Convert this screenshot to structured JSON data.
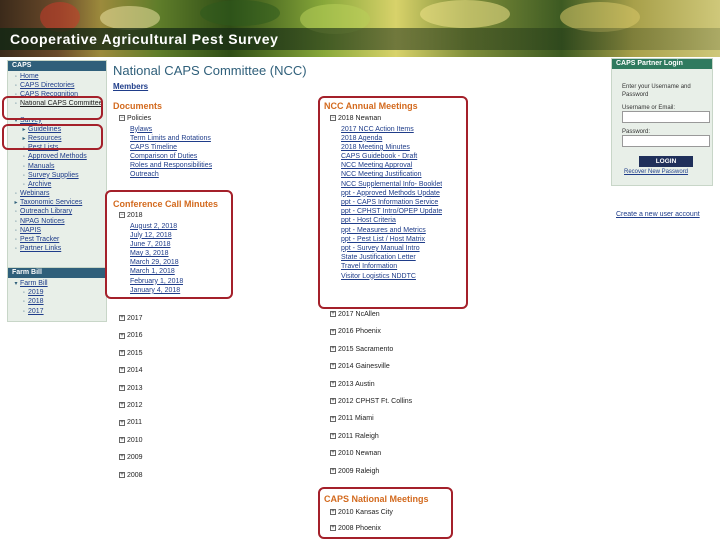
{
  "banner": {
    "title": "Cooperative Agricultural Pest Survey"
  },
  "sidebar": {
    "heading": "CAPS",
    "items": [
      {
        "label": "Home",
        "level": 0
      },
      {
        "label": "CAPS Directories",
        "level": 0
      },
      {
        "label": "CAPS Recognition",
        "level": 0
      },
      {
        "label": "National CAPS Committee",
        "level": 0
      },
      {
        "label": "Survey",
        "level": 0,
        "expanded": true
      },
      {
        "label": "Guidelines",
        "level": 1
      },
      {
        "label": "Resources",
        "level": 1
      },
      {
        "label": "Pest Lists",
        "level": 1
      },
      {
        "label": "Approved Methods",
        "level": 1
      },
      {
        "label": "Manuals",
        "level": 1
      },
      {
        "label": "Survey Supplies",
        "level": 1
      },
      {
        "label": "Archive",
        "level": 1
      },
      {
        "label": "Webinars",
        "level": 0
      },
      {
        "label": "Taxonomic Services",
        "level": 0
      },
      {
        "label": "Outreach Library",
        "level": 0
      },
      {
        "label": "NPAG Notices",
        "level": 0
      },
      {
        "label": "NAPIS",
        "level": 0
      },
      {
        "label": "Pest Tracker",
        "level": 0
      },
      {
        "label": "Partner Links",
        "level": 0
      }
    ]
  },
  "farmbill": {
    "heading": "Farm Bill",
    "parent": "Farm Bill",
    "years": [
      "2019",
      "2018",
      "2017"
    ]
  },
  "main": {
    "title": "National CAPS Committee (NCC)",
    "members_link": "Members",
    "documents": {
      "heading": "Documents",
      "policies_label": "Policies",
      "links": [
        "Bylaws",
        "Term Limits and Rotations",
        "CAPS Timeline",
        "Comparison of Duties",
        "Roles and Responsibilities",
        "Outreach"
      ]
    },
    "conference": {
      "heading": "Conference Call Minutes",
      "year": "2018",
      "dates": [
        "August 2, 2018",
        "July 12, 2018",
        "June 7, 2018",
        "May 3, 2018",
        "March 29, 2018",
        "March 1, 2018",
        "February 1, 2018",
        "January 4, 2018"
      ],
      "older_years": [
        "2017",
        "2016",
        "2015",
        "2014",
        "2013",
        "2012",
        "2011",
        "2010",
        "2009",
        "2008"
      ]
    },
    "annual": {
      "heading": "NCC Annual Meetings",
      "current": "2018 Newnan",
      "links": [
        "2017 NCC Action Items",
        "2018 Agenda",
        "2018 Meeting Minutes",
        "CAPS Guidebook - Draft",
        "NCC Meeting Approval",
        "NCC Meeting Justification",
        "NCC Supplemental Info- Booklet",
        "ppt - Approved Methods Update",
        "ppt - CAPS Information Service",
        "ppt - CPHST Intro/OPEP Update",
        "ppt - Host Criteria",
        "ppt - Measures and Metrics",
        "ppt - Pest List / Host Matrix",
        "ppt - Survey Manual Intro",
        "State Justification Letter",
        "Travel Information",
        "Visitor Logistics NDDTC"
      ],
      "older": [
        "2017 NcAllen",
        "2016 Phoenix",
        "2015 Sacramento",
        "2014 Gainesville",
        "2013 Austin",
        "2012 CPHST Ft. Collins",
        "2011 Miami",
        "2011 Raleigh",
        "2010 Newnan",
        "2009 Raleigh"
      ]
    },
    "national": {
      "heading": "CAPS National Meetings",
      "items": [
        "2010 Kansas City",
        "2008 Phoenix"
      ]
    }
  },
  "login": {
    "heading": "CAPS Partner Login",
    "instructions": "Enter your Username and Password",
    "username_label": "Username or Email:",
    "password_label": "Password:",
    "button": "LOGIN",
    "recover": "Recover New Password",
    "create": "Create a new user account"
  },
  "colors": {
    "accent": "#d36a1e",
    "nav_header": "#2f5f7a",
    "link": "#1f3d8a",
    "callout": "#a4202a"
  }
}
